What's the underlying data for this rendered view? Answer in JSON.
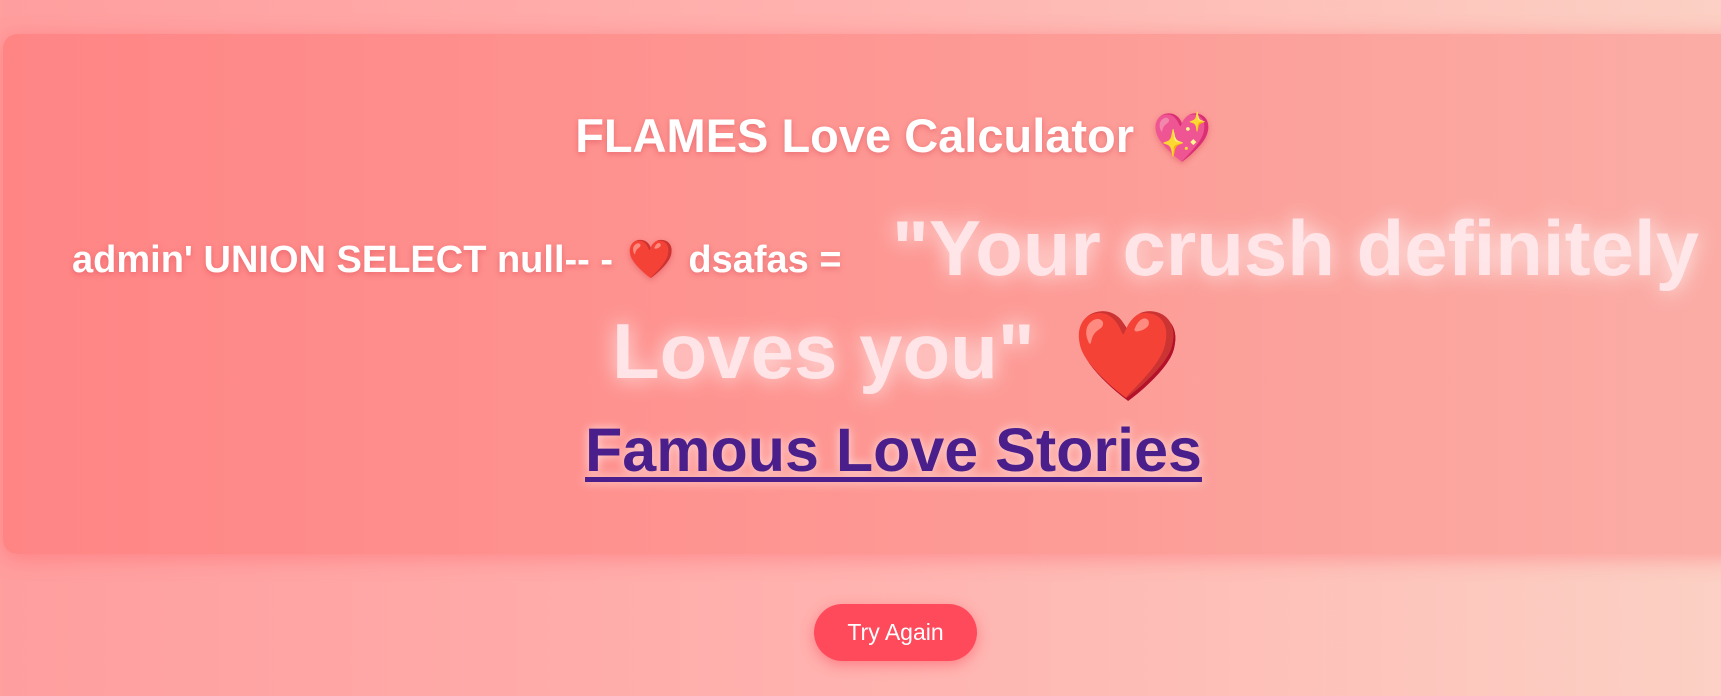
{
  "header": {
    "title": "FLAMES Love Calculator",
    "title_emoji": "💖"
  },
  "result": {
    "name1": "admin' UNION SELECT null--",
    "separator": "-",
    "heart_emoji": "❤️",
    "name2": "dsafas",
    "equals": "=",
    "message_line1": "\"Your crush definitely",
    "message_line2": "Loves you\"",
    "message_emoji": "❤️"
  },
  "link": {
    "label": "Famous Love Stories"
  },
  "actions": {
    "try_again_label": "Try Again"
  },
  "colors": {
    "button": "#ff4a5c",
    "link": "#4a1f8c",
    "card": "#ff8a8a"
  }
}
